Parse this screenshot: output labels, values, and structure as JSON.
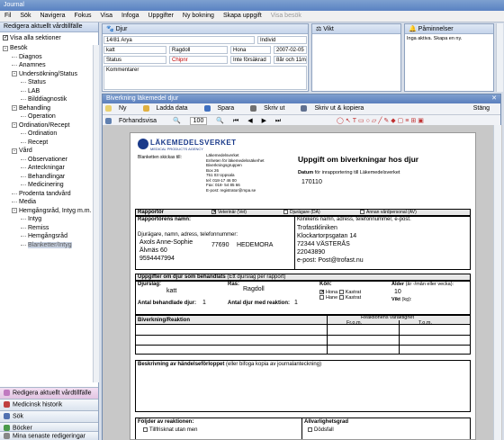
{
  "window": {
    "title": "Journal"
  },
  "menu": [
    "Fil",
    "Sök",
    "Navigera",
    "Fokus",
    "Visa",
    "Infoga",
    "Uppgifter",
    "Ny bokning",
    "Skapa uppgift",
    "Visa besök"
  ],
  "left": {
    "header": "Redigera aktuellt vårdtillfälle",
    "show_all": "Visa alla sektioner",
    "tree": [
      {
        "label": "Besök",
        "level": 1,
        "toggle": "-"
      },
      {
        "label": "Diagnos",
        "level": 2
      },
      {
        "label": "Anamnes",
        "level": 2
      },
      {
        "label": "Undersökning/Status",
        "level": 2,
        "toggle": "-"
      },
      {
        "label": "Status",
        "level": 3
      },
      {
        "label": "LAB",
        "level": 3
      },
      {
        "label": "Bilddiagnostik",
        "level": 3
      },
      {
        "label": "Behandling",
        "level": 2,
        "toggle": "-"
      },
      {
        "label": "Operation",
        "level": 3
      },
      {
        "label": "Ordination/Recept",
        "level": 2,
        "toggle": "-"
      },
      {
        "label": "Ordination",
        "level": 3
      },
      {
        "label": "Recept",
        "level": 3
      },
      {
        "label": "Vård",
        "level": 2,
        "toggle": "-"
      },
      {
        "label": "Observationer",
        "level": 3
      },
      {
        "label": "Anteckningar",
        "level": 3
      },
      {
        "label": "Behandlingar",
        "level": 3
      },
      {
        "label": "Medicinering",
        "level": 3
      },
      {
        "label": "Prodenta tandvård",
        "level": 2
      },
      {
        "label": "Media",
        "level": 2
      },
      {
        "label": "Hemgångsråd, Intyg m.m.",
        "level": 2,
        "toggle": "-"
      },
      {
        "label": "Intyg",
        "level": 3
      },
      {
        "label": "Remiss",
        "level": 3
      },
      {
        "label": "Hemgångsråd",
        "level": 3
      },
      {
        "label": "Blanketter/Intyg",
        "level": 3,
        "selected": true
      }
    ],
    "bottom_nav": [
      "Redigera aktuellt vårdtillfälle",
      "Medicinsk historik",
      "Sök",
      "Böcker",
      "Mina senaste redigeringar"
    ]
  },
  "animal": {
    "header": "Djur",
    "id": "14/81 Arya",
    "individ": "Individ",
    "species": "katt",
    "breed": "Ragdoll",
    "sex": "Hona",
    "dob": "2007-02-05",
    "status": "Status",
    "chip": "Chipnr",
    "insurance": "Inte försäkrad",
    "age": "8år och 11mr",
    "comment": "Kommentarer"
  },
  "weight": {
    "header": "Vikt"
  },
  "reminders": {
    "header": "Påminnelser",
    "text": "Inga aktiva. Skapa en ny."
  },
  "doc": {
    "title": "Biverkning läkemedel djur",
    "toolbar1": [
      "Ny",
      "Ladda data",
      "Spara",
      "Skriv ut",
      "Skriv ut & kopiera"
    ],
    "close": "Stäng",
    "preview": "Förhandsvisa",
    "zoom": "100"
  },
  "form": {
    "logo": "LÄKEMEDELSVERKET",
    "logo_sub": "MEDICAL PRODUCTS AGENCY",
    "send_to": "Blanketten skickas till:",
    "address": [
      "Läkemedelsverket",
      "Enheten för läkemedelssäkerhet",
      "Biverkningsgruppen",
      "Box 26",
      "751 03 Uppsala",
      "tel: 018-17 46 00",
      "Fax: 018- 54 85 66",
      "E-post: registrator@mpa.se"
    ],
    "heading": "Uppgift om biverkningar hos djur",
    "date_label": "Datum",
    "date_note": "för inrapportering till Läkemedelsverket",
    "date": "170110",
    "reporter": "Rapportör",
    "opt_vet": "Veterinär (Vet)",
    "opt_pharm": "Djurägare (DA)",
    "opt_other": "Annan vårdpersonal (AV)",
    "reporter_name": "Rapportörens namn:",
    "clinic_label": "Klinikens namn, adress, telefonnummer, e-post.",
    "clinic": [
      "Trofastkliniken",
      "Klockartorpsgatan 14",
      "72344     VÄSTERÅS",
      "22043890",
      "e-post: Post@trofast.nu"
    ],
    "owner_label": "Djurägare, namn, adress, telefonnummer:",
    "owner": [
      "Axols Anne-Sophie",
      "Älvnäs 60",
      "9594447994"
    ],
    "owner_zip": "77690",
    "owner_city": "HEDEMORA",
    "animals_label": "Uppgifter om djur som behandlats",
    "animals_note": "(Ett djurslag per rapport)",
    "species_label": "Djurslag:",
    "species": "katt",
    "breed_label": "Ras:",
    "breed": "Ragdoll",
    "sex_label": "Kön:",
    "sex_opts": [
      "Hona",
      "Kastrat",
      "Hane",
      "Kastrat"
    ],
    "age_label": "Ålder",
    "age_note": "(år -/mån eller vecka):",
    "age": "10",
    "weight_label": "Vikt",
    "weight_unit": "(kg):",
    "treated_label": "Antal behandlade djur:",
    "treated": "1",
    "reacted_label": "Antal djur med reaktion:",
    "reacted": "1",
    "reaction_label": "Biverkning/Reaktion",
    "duration_label": "Reaktionens varaktighet",
    "from": "Fr.o.m.",
    "to": "T.o.m.",
    "desc_label": "Beskrivning av händelseförloppet",
    "desc_note": "(eller bifoga kopia av journalanteckning)",
    "followup_label": "Följder av reaktionen:",
    "followup_opt": "Tillfrisknat utan men",
    "severity_label": "Allvarlighetsgrad",
    "severity_opt": "Dödsfall"
  }
}
